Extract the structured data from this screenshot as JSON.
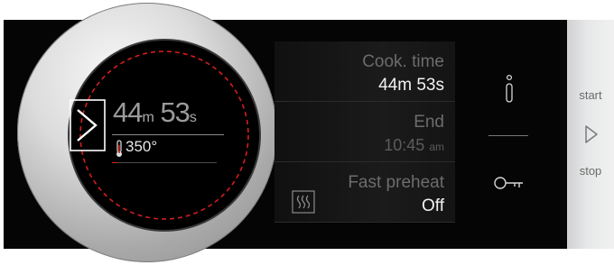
{
  "dial": {
    "minutes": "44",
    "minutes_unit": "m",
    "seconds": "53",
    "seconds_unit": "s",
    "temperature": "350°"
  },
  "rows": [
    {
      "title": "Cook. time",
      "value": "44m 53s"
    },
    {
      "title": "End",
      "value": "10:45",
      "value_unit": "am"
    },
    {
      "title": "Fast preheat",
      "value": "Off"
    }
  ],
  "side": {
    "start_label": "start",
    "stop_label": "stop"
  },
  "icons": {
    "play": "play-icon",
    "thermometer": "thermometer-icon",
    "info": "info-icon",
    "key": "key-icon",
    "preheat": "fast-preheat-icon",
    "start_stop": "start-stop-icon"
  },
  "colors": {
    "accent": "#e0261c",
    "panel": "#050505"
  }
}
